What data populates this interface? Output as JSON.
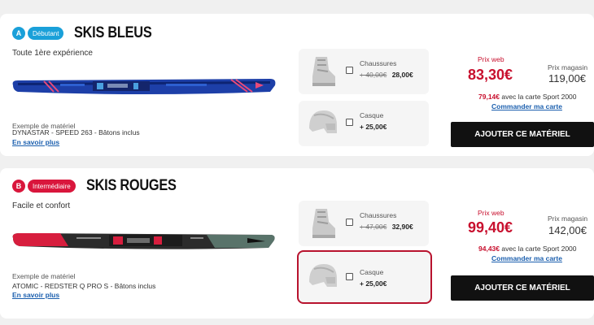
{
  "cards": [
    {
      "level_letter": "A",
      "level_label": "Débutant",
      "level_color": "#1aa0d9",
      "title": "SKIS BLEUS",
      "subtitle": "Toute 1ère expérience",
      "example_label": "Exemple de matériel",
      "model": "DYNASTAR - SPEED 263 - Bâtons inclus",
      "more_link": "En savoir plus",
      "options": [
        {
          "name": "Chaussures",
          "old_price": "+ 40,00€",
          "price": "28,00€",
          "icon": "ski-boot-icon"
        },
        {
          "name": "Casque",
          "old_price": "",
          "price": "+ 25,00€",
          "icon": "helmet-icon"
        }
      ],
      "web_label": "Prix web",
      "web_price": "83,30€",
      "store_label": "Prix magasin",
      "store_price": "119,00€",
      "card_price": "79,14€",
      "card_price_text": "avec la carte Sport 2000",
      "card_link": "Commander ma carte",
      "button": "AJOUTER CE MATÉRIEL"
    },
    {
      "level_letter": "B",
      "level_label": "Intermédiaire",
      "level_color": "#d9163c",
      "title": "SKIS ROUGES",
      "subtitle": "Facile et confort",
      "example_label": "Exemple de matériel",
      "model": "ATOMIC - REDSTER Q PRO S - Bâtons inclus",
      "more_link": "En savoir plus",
      "options": [
        {
          "name": "Chaussures",
          "old_price": "+ 47,00€",
          "price": "32,90€",
          "icon": "ski-boot-icon"
        },
        {
          "name": "Casque",
          "old_price": "",
          "price": "+ 25,00€",
          "icon": "helmet-icon",
          "highlighted": true
        }
      ],
      "web_label": "Prix web",
      "web_price": "99,40€",
      "store_label": "Prix magasin",
      "store_price": "142,00€",
      "card_price": "94,43€",
      "card_price_text": "avec la carte Sport 2000",
      "card_link": "Commander ma carte",
      "button": "AJOUTER CE MATÉRIEL"
    }
  ],
  "colors": {
    "web_price": "#c8102e",
    "link": "#1b5fae",
    "button_bg": "#111111",
    "highlight": "#b8132e"
  }
}
